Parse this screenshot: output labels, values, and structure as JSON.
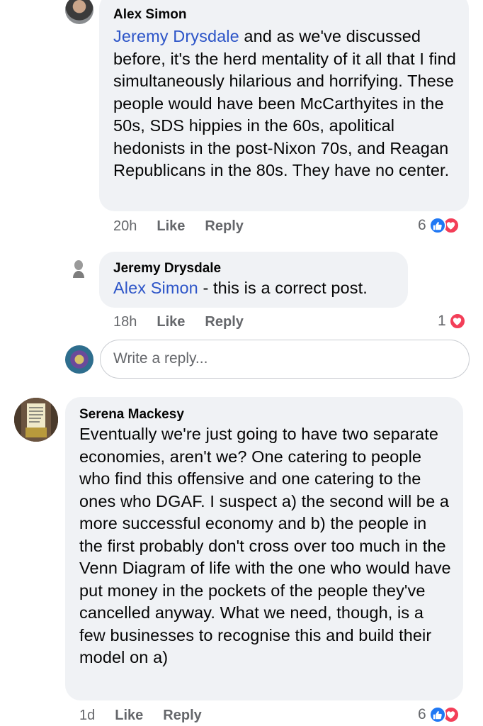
{
  "comments": [
    {
      "author": "Alex Simon",
      "mention": "Jeremy Drysdale",
      "text": " and as we've discussed before, it's the herd mentality of it all that I find simultaneously hilarious and horrifying. These people would have been McCarthyites in the 50s, SDS hippies in the 60s, apolitical hedonists in the post-Nixon 70s, and Reagan Republicans in the 80s. They have no center.",
      "time": "20h",
      "like_label": "Like",
      "reply_label": "Reply",
      "reaction_count": "6",
      "reactions": [
        "like-icon",
        "love-icon"
      ]
    },
    {
      "author": "Jeremy Drysdale",
      "mention": "Alex Simon",
      "text": " - this is a correct post.",
      "time": "18h",
      "like_label": "Like",
      "reply_label": "Reply",
      "reaction_count": "1",
      "reactions": [
        "love-icon"
      ]
    },
    {
      "author": "Serena Mackesy",
      "text": "Eventually we're just going to have two separate economies, aren't we? One catering to people who find this offensive and one catering to the ones who DGAF. I suspect a) the second will be a more successful economy and b) the people in the first probably don't cross over too much in the Venn Diagram of life with the one who would have put money in the pockets of the people they've cancelled anyway. What we need, though, is a few businesses to recognise this and build their model on a)",
      "time": "1d",
      "like_label": "Like",
      "reply_label": "Reply",
      "reaction_count": "6",
      "reactions": [
        "like-icon",
        "love-icon"
      ]
    }
  ],
  "reply_input": {
    "placeholder": "Write a reply..."
  },
  "colors": {
    "bubble": "#f0f2f5",
    "mention": "#2d55c8",
    "like": "#2078f4",
    "love": "#f33e58",
    "meta": "#65676b"
  }
}
